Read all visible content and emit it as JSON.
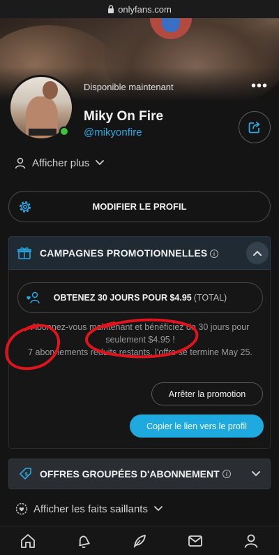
{
  "browser": {
    "url": "onlyfans.com"
  },
  "profile": {
    "status": "Disponible maintenant",
    "name": "Miky On Fire",
    "handle": "@mikyonfire",
    "online": true
  },
  "show_more_label": "Afficher plus",
  "edit_profile_label": "MODIFIER LE PROFIL",
  "promo": {
    "section_title": "CAMPAGNES PROMOTIONNELLES",
    "offer_main": "OBTENEZ 30 JOURS POUR $4.95",
    "offer_suffix": "(TOTAL)",
    "description_line1": "Abonnez-vous maintenant et bénéficiez de 30 jours pour seulement $4.95 !",
    "description_line2": "7 abonnements réduits restants. l'offre se termine May 25.",
    "stop_button": "Arrêter la promotion",
    "copy_button": "Copier le lien vers le profil"
  },
  "bundles": {
    "section_title": "OFFRES GROUPÉES D'ABONNEMENT"
  },
  "highlights_label": "Afficher les faits saillants",
  "colors": {
    "accent": "#1eaadf",
    "link": "#2aa7e0",
    "annotation": "#e0141c",
    "online": "#3dc43d"
  },
  "icons": [
    "lock-icon",
    "more-icon",
    "share-icon",
    "user-icon",
    "chevron-down-icon",
    "gear-icon",
    "gift-icon",
    "info-icon",
    "chevron-up-icon",
    "user-heart-icon",
    "price-tag-icon",
    "highlight-icon",
    "home-icon",
    "bell-icon",
    "feather-icon",
    "mail-icon",
    "profile-icon"
  ]
}
